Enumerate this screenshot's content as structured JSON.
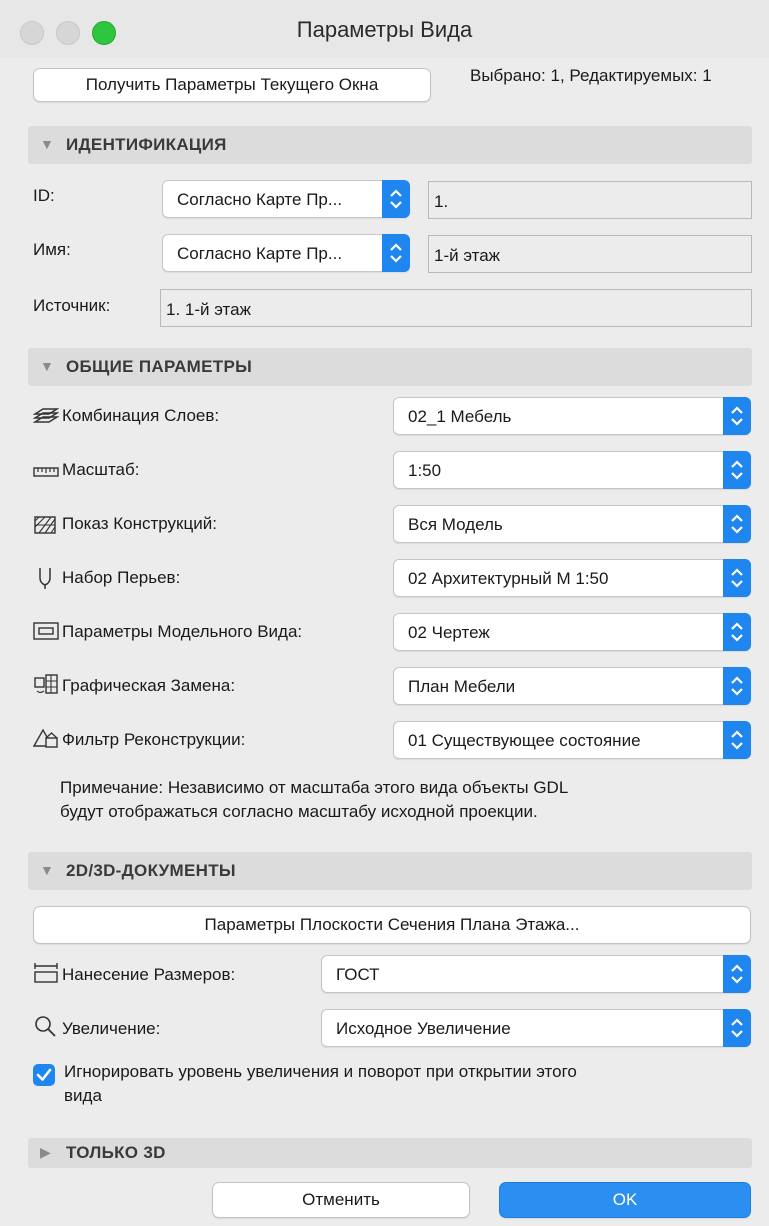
{
  "window": {
    "title": "Параметры Вида"
  },
  "header": {
    "get_params_button": "Получить Параметры Текущего Окна",
    "selected_info": "Выбрано: 1, Редактируемых: 1"
  },
  "identification": {
    "title": "ИДЕНТИФИКАЦИЯ",
    "id_label": "ID:",
    "id_mode": "Согласно Карте Пр...",
    "id_value": "1.",
    "name_label": "Имя:",
    "name_mode": "Согласно Карте Пр...",
    "name_value": "1-й этаж",
    "source_label": "Источник:",
    "source_value": "1. 1-й этаж"
  },
  "general": {
    "title": "ОБЩИЕ ПАРАМЕТРЫ",
    "rows": [
      {
        "label": "Комбинация Слоев:",
        "value": "02_1 Мебель",
        "icon": "layers-icon"
      },
      {
        "label": "Масштаб:",
        "value": "1:50",
        "icon": "ruler-icon"
      },
      {
        "label": "Показ Конструкций:",
        "value": "Вся Модель",
        "icon": "structure-display-icon"
      },
      {
        "label": "Набор Перьев:",
        "value": "02 Архитектурный М 1:50",
        "icon": "pen-icon"
      },
      {
        "label": "Параметры Модельного Вида:",
        "value": "02 Чертеж",
        "icon": "model-view-icon"
      },
      {
        "label": "Графическая Замена:",
        "value": "План Мебели",
        "icon": "graphic-override-icon"
      },
      {
        "label": "Фильтр Реконструкции:",
        "value": "01 Существующее состояние",
        "icon": "renovation-filter-icon"
      }
    ],
    "note_line1": "Примечание: Независимо от масштаба этого вида объекты GDL",
    "note_line2": "будут отображаться согласно масштабу исходной проекции."
  },
  "docs": {
    "title": "2D/3D-ДОКУМЕНТЫ",
    "cut_plane_button": "Параметры Плоскости Сечения Плана Этажа...",
    "dimension_label": "Нанесение Размеров:",
    "dimension_value": "ГОСТ",
    "zoom_label": "Увеличение:",
    "zoom_value": "Исходное Увеличение",
    "ignore_zoom_line1": "Игнорировать уровень увеличения и поворот при открытии этого",
    "ignore_zoom_line2": "вида"
  },
  "only3d": {
    "title": "ТОЛЬКО 3D"
  },
  "footer": {
    "cancel": "Отменить",
    "ok": "OK"
  },
  "colors": {
    "accent": "#1f86ef",
    "section_bg": "#dcdcdc",
    "window_bg": "#ececec"
  }
}
